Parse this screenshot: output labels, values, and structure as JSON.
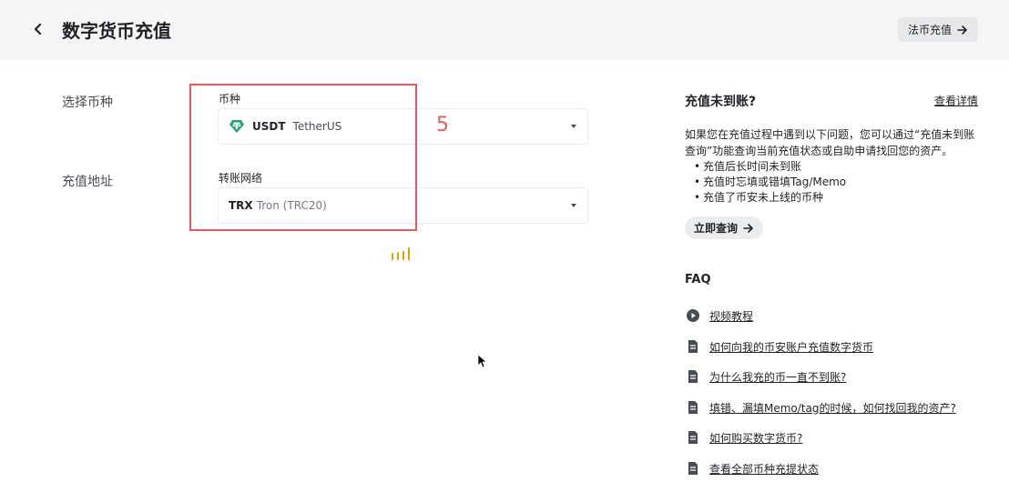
{
  "header": {
    "title": "数字货币充值",
    "fiat_button": "法币充值"
  },
  "form": {
    "select_coin_label": "选择币种",
    "deposit_address_label": "充值地址",
    "coin_field_label": "币种",
    "coin_symbol": "USDT",
    "coin_name": "TetherUS",
    "network_field_label": "转账网络",
    "network_symbol": "TRX",
    "network_name": "Tron (TRC20)"
  },
  "annotation": {
    "number": "5",
    "color": "#e85a5a"
  },
  "sidebar": {
    "title": "充值未到账?",
    "details_link": "查看详情",
    "description": "如果您在充值过程中遇到以下问题，您可以通过“充值未到账查询”功能查询当前充值状态或自助申请找回您的资产。",
    "issues": [
      "充值后长时间未到账",
      "充值时忘填或错填Tag/Memo",
      "充值了币安未上线的币种"
    ],
    "query_button": "立即查询"
  },
  "faq": {
    "title": "FAQ",
    "items": [
      {
        "icon": "play-icon",
        "label": "视频教程"
      },
      {
        "icon": "document-icon",
        "label": "如何向我的币安账户充值数字货币"
      },
      {
        "icon": "document-icon",
        "label": "为什么我充的币一直不到账?"
      },
      {
        "icon": "document-icon",
        "label": "填错、漏填Memo/tag的时候，如何找回我的资产?"
      },
      {
        "icon": "document-icon",
        "label": "如何购买数字货币?"
      },
      {
        "icon": "document-icon",
        "label": "查看全部币种充提状态"
      }
    ]
  },
  "colors": {
    "brand_tether": "#26a17b",
    "loader": "#d9a300"
  }
}
